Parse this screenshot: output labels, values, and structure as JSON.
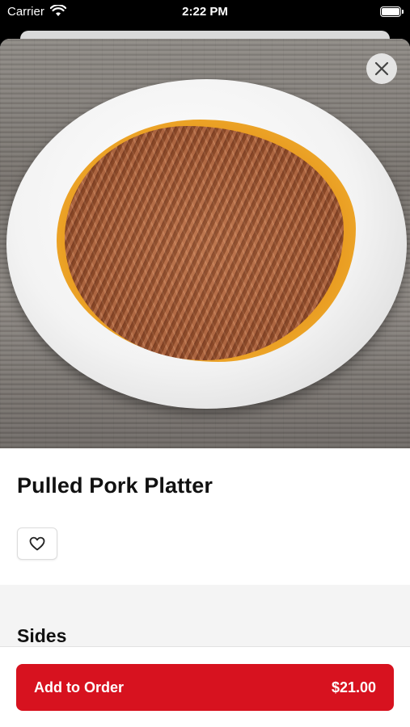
{
  "status_bar": {
    "carrier": "Carrier",
    "time": "2:22 PM"
  },
  "item": {
    "name": "Pulled Pork Platter",
    "image": "pulled-pork-platter-photo"
  },
  "sections": [
    {
      "title": "Sides"
    }
  ],
  "footer": {
    "add_label": "Add to Order",
    "price": "$21.00"
  },
  "icons": {
    "close": "close-icon",
    "favorite": "heart-icon",
    "wifi": "wifi-icon",
    "battery": "battery-icon"
  },
  "colors": {
    "accent": "#d7121f",
    "section_bg": "#f4f4f4"
  }
}
